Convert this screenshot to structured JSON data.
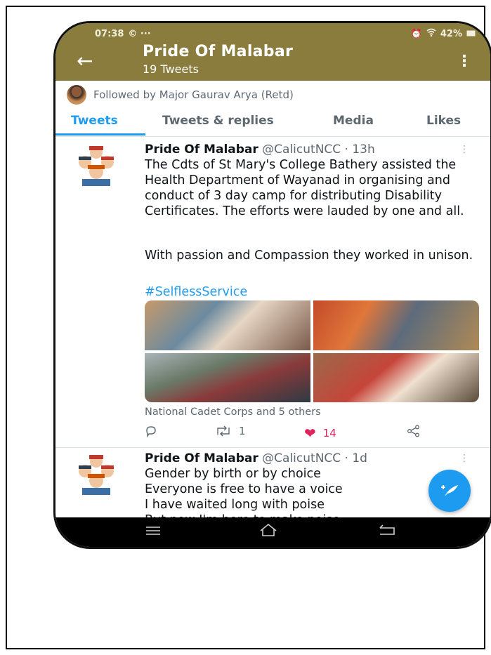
{
  "status": {
    "time": "07:38",
    "left_icons": "© ···",
    "battery": "42%"
  },
  "header": {
    "title": "Pride Of Malabar",
    "subtitle": "19 Tweets"
  },
  "followed_by": "Followed by Major Gaurav Arya (Retd)",
  "tabs": [
    "Tweets",
    "Tweets & replies",
    "Media",
    "Likes"
  ],
  "tweets": [
    {
      "name": "Pride Of Malabar",
      "handle": "@CalicutNCC · 13h",
      "paragraphs": [
        "The Cdts of St Mary's College Bathery assisted the Health Department of Wayanad in organising and conduct of 3 day camp for distributing Disability Certificates. The efforts were lauded by one and all.",
        "With passion and Compassion they worked in unison."
      ],
      "hashtag": "#SelflessService",
      "caption": "National Cadet Corps and 5 others",
      "retweets": "1",
      "likes": "14"
    },
    {
      "name": "Pride Of Malabar",
      "handle": "@CalicutNCC · 1d",
      "lines": [
        "Gender by birth or by choice",
        "Everyone is free to have a voice",
        "I have waited long with poise",
        "But now I'm here to make noise"
      ]
    }
  ],
  "icons": {
    "back": "arrow-left-icon",
    "more": "kebab-icon",
    "reply": "reply-icon",
    "retweet": "retweet-icon",
    "like": "heart-icon",
    "share": "share-icon",
    "compose": "compose-icon"
  },
  "colors": {
    "header": "#8a7c3c",
    "accent": "#1d9bf0",
    "like": "#e0245e"
  }
}
